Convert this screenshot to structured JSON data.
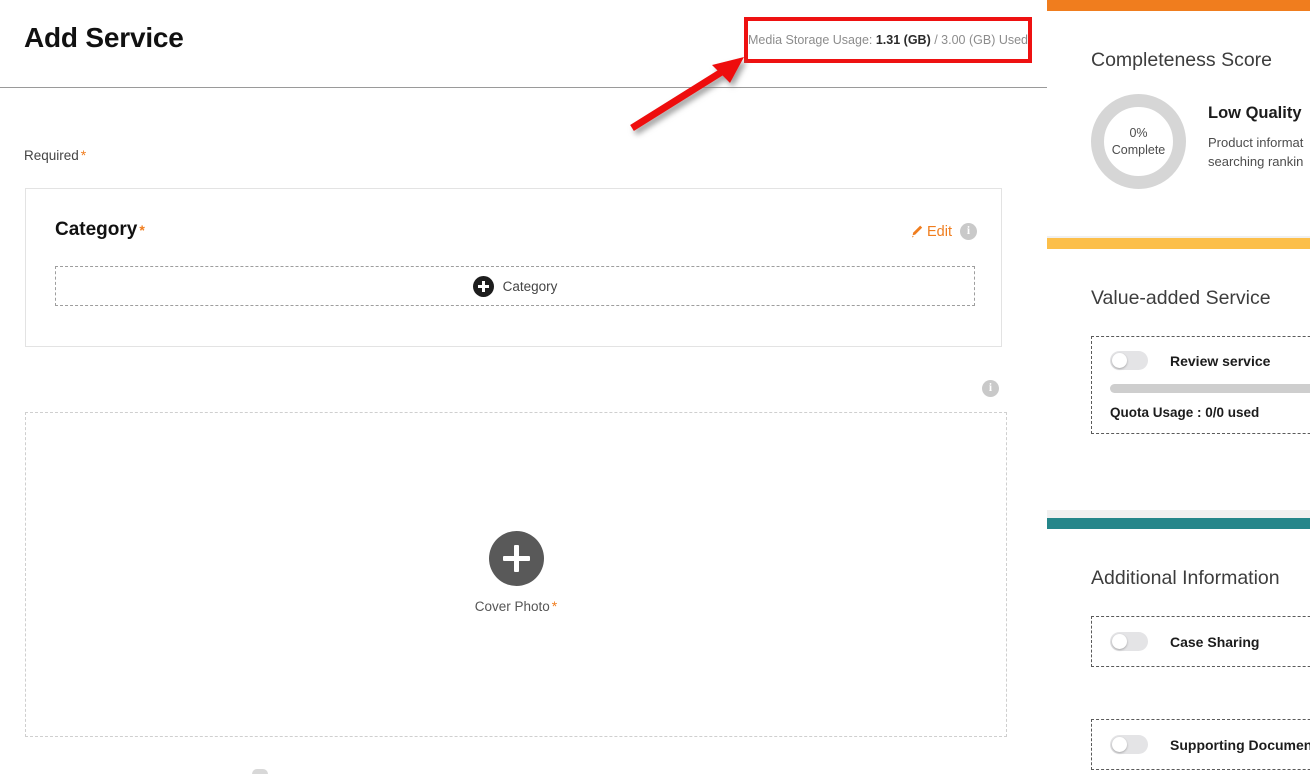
{
  "header": {
    "title": "Add Service",
    "storage": {
      "prefix": "Media Storage Usage: ",
      "used": "1.31 (GB)",
      "suffix": " / 3.00 (GB) Used"
    }
  },
  "form": {
    "required_note": "Required",
    "required_marker": "*",
    "category": {
      "heading": "Category",
      "heading_marker": "*",
      "edit_label": "Edit",
      "info_glyph": "i",
      "add_button_label": "Category"
    },
    "cover": {
      "info_glyph": "i",
      "label": "Cover Photo",
      "label_marker": "*"
    }
  },
  "sidebar": {
    "completeness": {
      "accent": "#f07d1e",
      "title": "Completeness Score",
      "percent": "0%",
      "percent_caption": "Complete",
      "quality": "Low Quality",
      "description_line1": "Product informat",
      "description_line2": "searching rankin"
    },
    "value_added": {
      "accent": "#fcbf4a",
      "title": "Value-added Service",
      "toggle_label": "Review service",
      "quota_text": "Quota Usage : 0/0 used"
    },
    "additional": {
      "accent": "#25868a",
      "title": "Additional Information",
      "items": [
        {
          "label": "Case Sharing"
        },
        {
          "label": "Supporting Document"
        }
      ]
    }
  },
  "annotation": {
    "highlight_color": "#ee1111",
    "arrow_color": "#ee1111"
  }
}
